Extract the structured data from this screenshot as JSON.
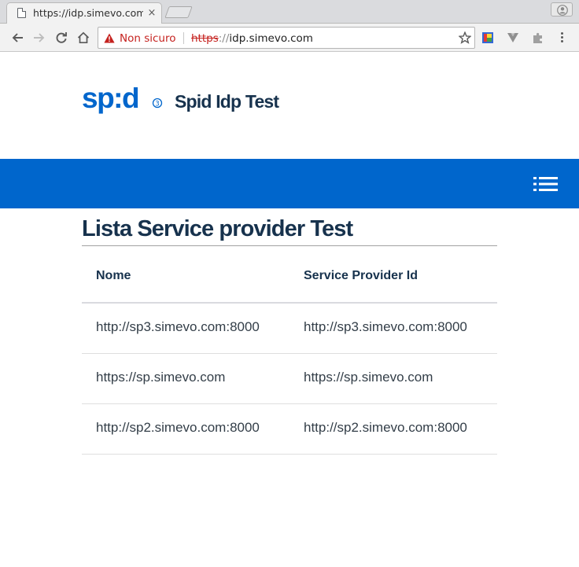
{
  "browser": {
    "tab_title": "https://idp.simevo.com",
    "tab_close": "×",
    "security_label": "Non sicuro",
    "url_scheme": "https",
    "url_separator": "://",
    "url_host": "idp.simevo.com"
  },
  "site": {
    "title": "Spid Idp Test",
    "logo_text": "sp:d"
  },
  "main": {
    "heading": "Lista Service provider Test",
    "table": {
      "headers": [
        "Nome",
        "Service Provider Id"
      ],
      "rows": [
        [
          "http://sp3.simevo.com:8000",
          "http://sp3.simevo.com:8000"
        ],
        [
          "https://sp.simevo.com",
          "https://sp.simevo.com"
        ],
        [
          "http://sp2.simevo.com:8000",
          "http://sp2.simevo.com:8000"
        ]
      ]
    }
  },
  "colors": {
    "brand_blue": "#0066cc",
    "heading_text": "#17324d",
    "warning_red": "#c5221f"
  }
}
